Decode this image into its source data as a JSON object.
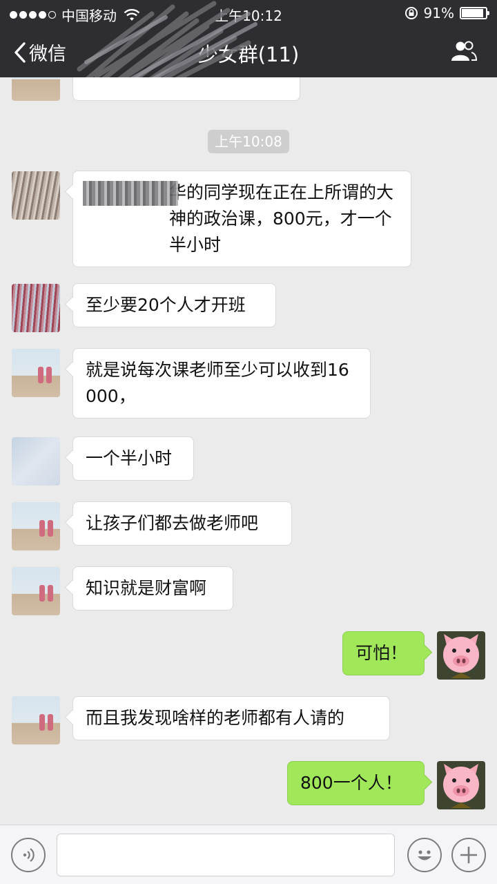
{
  "status_bar": {
    "carrier": "中国移动",
    "time": "上午10:12",
    "battery_percent": "91%",
    "battery_level": 0.91,
    "icons": [
      "signal-dots-icon",
      "wifi-icon",
      "rotation-lock-icon",
      "battery-icon"
    ]
  },
  "nav": {
    "back_label": "微信",
    "title": "少女群(11)",
    "group_icon": "group-members-icon"
  },
  "chat": {
    "timestamp": "上午10:08",
    "messages": [
      {
        "side": "left",
        "text": "华的同学现在正在上所谓的大神的政治课，800元，才一个半小时"
      },
      {
        "side": "left",
        "text": "至少要20个人才开班"
      },
      {
        "side": "left",
        "text": "就是说每次课老师至少可以收到16000，"
      },
      {
        "side": "left",
        "text": "一个半小时"
      },
      {
        "side": "left",
        "text": "让孩子们都去做老师吧"
      },
      {
        "side": "left",
        "text": "知识就是财富啊"
      },
      {
        "side": "right",
        "text": "可怕！"
      },
      {
        "side": "left",
        "text": "而且我发现啥样的老师都有人请的"
      },
      {
        "side": "right",
        "text": "800一个人！"
      }
    ]
  },
  "input_bar": {
    "voice_icon": "voice-icon",
    "emoji_icon": "emoji-icon",
    "add_icon": "plus-icon",
    "placeholder": ""
  }
}
